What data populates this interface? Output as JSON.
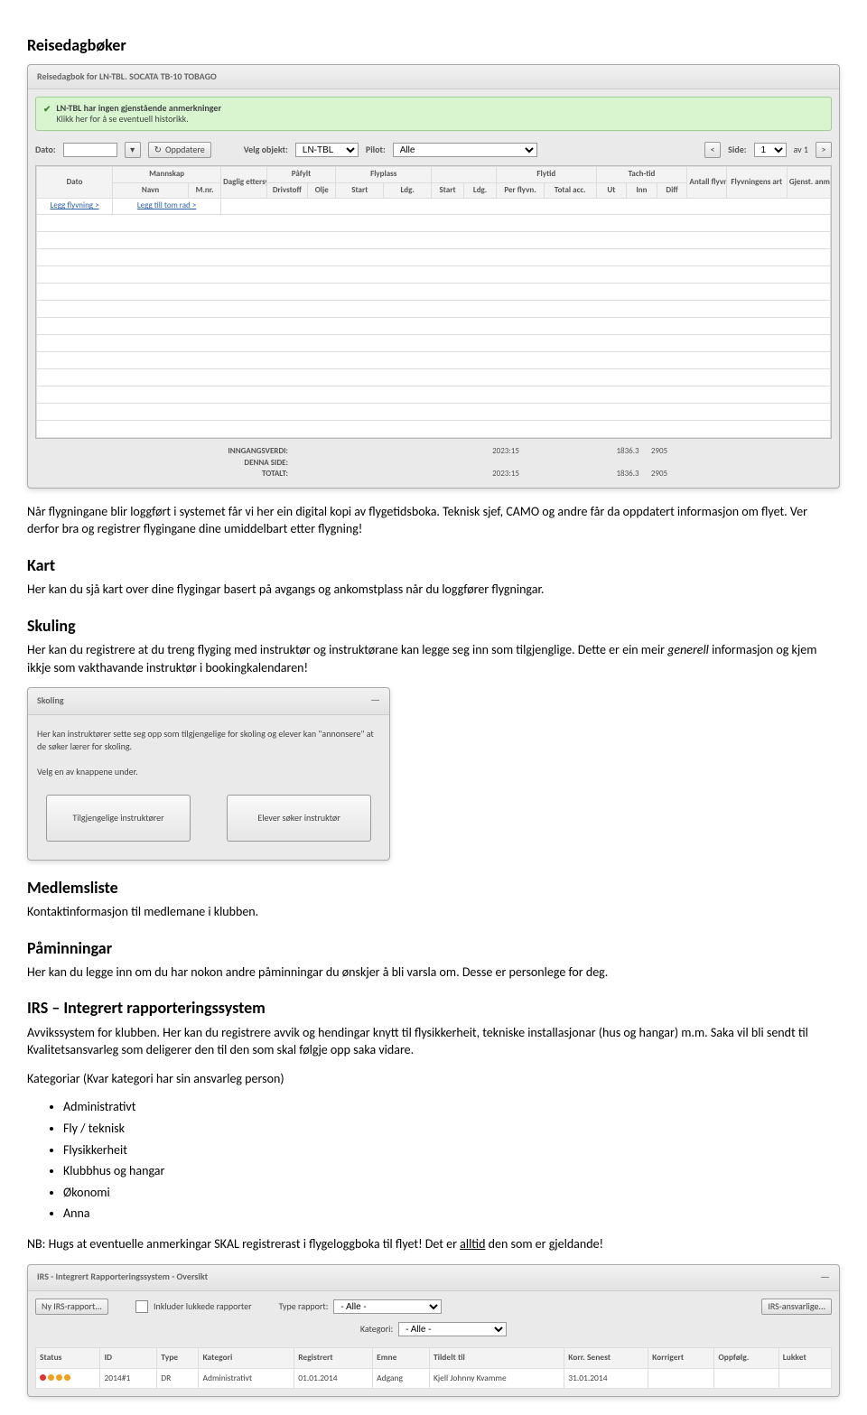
{
  "sections": {
    "reisedagboker": {
      "title": "Reisedagbøker",
      "body": "Når flygningane blir loggført i systemet får vi her ein digital kopi av flygetidsboka. Teknisk sjef, CAMO og andre får da oppdatert informasjon om flyet. Ver derfor bra og registrer flygingane dine umiddelbart etter flygning!"
    },
    "kart": {
      "title": "Kart",
      "body": "Her kan du sjå kart over dine flygingar basert på avgangs og ankomstplass når du loggfører flygningar."
    },
    "skuling": {
      "title": "Skuling",
      "body_pre": "Her kan du registrere at du treng flyging med instruktør og instruktørane kan legge seg inn som tilgjenglige. Dette er ein meir ",
      "body_italic": "generell",
      "body_post": " informasjon og kjem ikkje som vakthavande instruktør i bookingkalendaren!"
    },
    "medlemsliste": {
      "title": "Medlemsliste",
      "body": "Kontaktinformasjon til medlemane i klubben."
    },
    "paminningar": {
      "title": "Påminningar",
      "body": "Her kan du legge inn om du har nokon andre påminningar du ønskjer å bli varsla om. Desse er personlege for deg."
    },
    "irs": {
      "title": "IRS – Integrert rapporteringssystem",
      "body": "Avvikssystem for klubben. Her kan du registrere avvik og hendingar knytt til flysikkerheit, tekniske installasjonar (hus og hangar) m.m. Saka vil bli sendt til Kvalitetsansvarleg som deligerer den til den som skal følgje opp saka vidare.",
      "categories_intro": "Kategoriar (Kvar kategori har sin ansvarleg person)",
      "categories": [
        "Administrativt",
        "Fly / teknisk",
        "Flysikkerheit",
        "Klubbhus og hangar",
        "Økonomi",
        "Anna"
      ],
      "nb_pre": "NB: Hugs at eventuelle anmerkingar SKAL registrerast i flygeloggboka til flyet! Det er ",
      "nb_underline": "alltid",
      "nb_post": " den som er gjeldande!"
    }
  },
  "reisedagbok_panel": {
    "header": "Reisedagbok for LN-TBL. SOCATA TB-10 TOBAGO",
    "banner_line1": "LN-TBL har ingen gjenstående anmerkninger",
    "banner_line2": "Klikk her for å se eventuell historikk.",
    "toolbar": {
      "dato_label": "Dato:",
      "cal_icon": "▾",
      "oppdatere": "Oppdatere",
      "refresh_icon": "↻",
      "velg_objekt_label": "Velg objekt:",
      "velg_objekt_value": "LN-TBL",
      "pilot_label": "Pilot:",
      "pilot_value": "Alle",
      "prev": "<",
      "side_label": "Side:",
      "side_value": "1",
      "av_label": "av 1",
      "next": ">"
    },
    "grid": {
      "group_headers": [
        "Dato",
        "Mannskap",
        "Daglig ettersyn",
        "Påfylt",
        "Flyplass",
        "",
        "Flytid",
        "",
        "Tach-tid",
        "Antall flyvn.",
        "Flyvningens art",
        "Gjenst. anm."
      ],
      "sub_headers": [
        "",
        "Navn",
        "M.nr.",
        "",
        "Drivstoff",
        "Olje",
        "Start",
        "Ldg.",
        "Start",
        "Ldg.",
        "Per flyvn.",
        "Total acc.",
        "Ut",
        "Inn",
        "Diff",
        "",
        "",
        ""
      ],
      "row_links": [
        "Legg flyvning >",
        "Legg till tom rad >"
      ],
      "totals": [
        {
          "label": "INNGANGSVERDI:",
          "flytid": "2023:15",
          "tach": "1836.3",
          "ant": "2905"
        },
        {
          "label": "DENNA SIDE:",
          "flytid": "",
          "tach": "",
          "ant": ""
        },
        {
          "label": "TOTALT:",
          "flytid": "2023:15",
          "tach": "1836.3",
          "ant": "2905"
        }
      ]
    }
  },
  "skoling_panel": {
    "header": "Skoling",
    "desc_line1": "Her kan instruktører sette seg opp som tilgjengelige for skoling og elever kan \"annonsere\" at de søker lærer for skoling.",
    "desc_line2": "Velg en av knappene under.",
    "btn1": "Tilgjengelige instruktører",
    "btn2": "Elever søker instruktør"
  },
  "irs_panel": {
    "header": "IRS - Integrert Rapporteringssystem - Oversikt",
    "btn_new": "Ny IRS-rapport...",
    "cb_label": "Inkluder lukkede rapporter",
    "type_label": "Type rapport:",
    "type_value": "- Alle -",
    "btn_ansvar": "IRS-ansvarlige...",
    "kat_label": "Kategori:",
    "kat_value": "- Alle -",
    "columns": [
      "Status",
      "ID",
      "Type",
      "Kategori",
      "Registrert",
      "Emne",
      "Tildelt til",
      "Korr. Senest",
      "Korrigert",
      "Oppfølg.",
      "Lukket"
    ],
    "row": {
      "id": "2014#1",
      "type": "DR",
      "kategori": "Administrativt",
      "registrert": "01.01.2014",
      "emne": "Adgang",
      "tildelt": "Kjell Johnny Kvamme",
      "korr_senest": "31.01.2014"
    }
  }
}
